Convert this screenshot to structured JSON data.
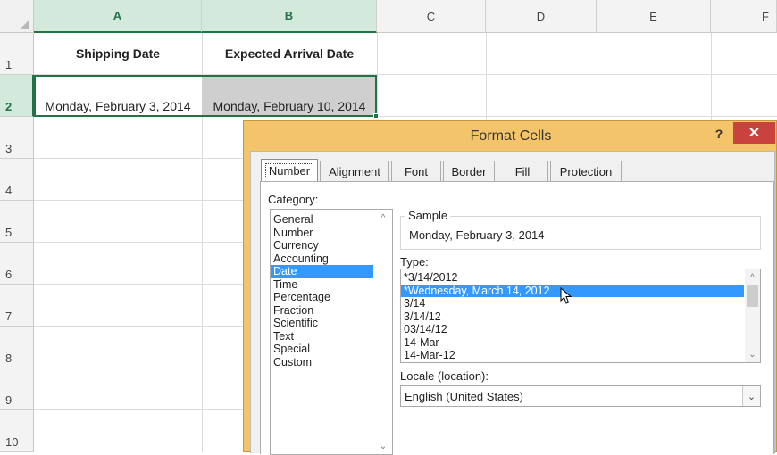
{
  "columns": [
    "A",
    "B",
    "C",
    "D",
    "E",
    "F"
  ],
  "rows": [
    "1",
    "2",
    "3",
    "4",
    "5",
    "6",
    "7",
    "8",
    "9",
    "10"
  ],
  "cells": {
    "A1": "Shipping Date",
    "B1": "Expected Arrival Date",
    "A2": "Monday, February 3, 2014",
    "B2": "Monday, February 10, 2014"
  },
  "dialog": {
    "title": "Format Cells",
    "help": "?",
    "close": "✕",
    "tabs": [
      "Number",
      "Alignment",
      "Font",
      "Border",
      "Fill",
      "Protection"
    ],
    "active_tab": "Number",
    "category_label": "Category:",
    "categories": [
      "General",
      "Number",
      "Currency",
      "Accounting",
      "Date",
      "Time",
      "Percentage",
      "Fraction",
      "Scientific",
      "Text",
      "Special",
      "Custom"
    ],
    "selected_category": "Date",
    "sample_label": "Sample",
    "sample_value": "Monday, February 3, 2014",
    "type_label": "Type:",
    "types": [
      "*3/14/2012",
      "*Wednesday, March 14, 2012",
      "3/14",
      "3/14/12",
      "03/14/12",
      "14-Mar",
      "14-Mar-12"
    ],
    "selected_type": "*Wednesday, March 14, 2012",
    "locale_label": "Locale (location):",
    "locale_value": "English (United States)"
  },
  "icons": {
    "up": "▲",
    "down": "▼",
    "chev_up": "^",
    "chev_down": "⌄"
  },
  "colors": {
    "excel_green": "#217346",
    "dialog_frame": "#f4c46b",
    "close_red": "#c9423d",
    "selection_blue": "#3399ff"
  }
}
